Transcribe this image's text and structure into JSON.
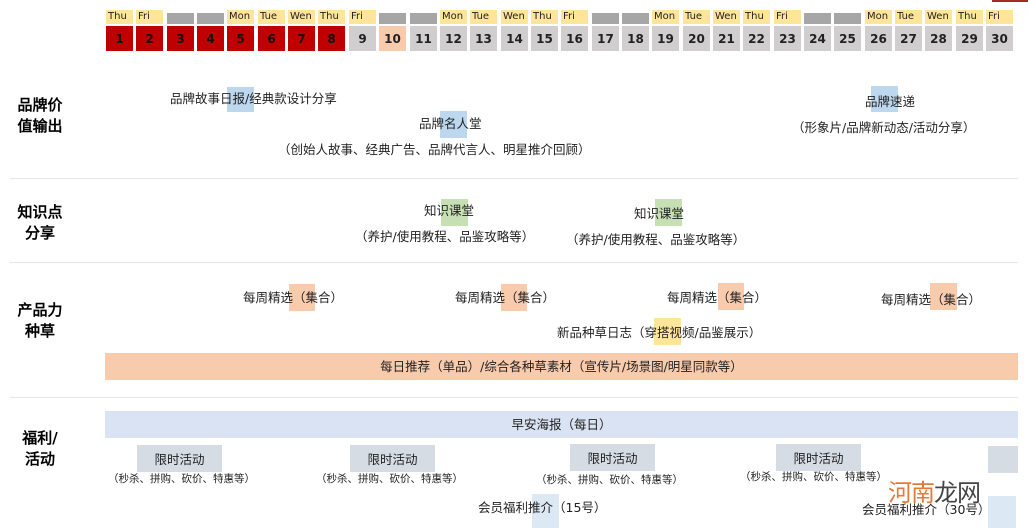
{
  "calendar": {
    "days": [
      {
        "date": "1",
        "dow": "Thu",
        "weekend": false,
        "status": "red"
      },
      {
        "date": "2",
        "dow": "Fri",
        "weekend": false,
        "status": "red"
      },
      {
        "date": "3",
        "dow": "",
        "weekend": true,
        "status": "red"
      },
      {
        "date": "4",
        "dow": "",
        "weekend": true,
        "status": "red"
      },
      {
        "date": "5",
        "dow": "Mon",
        "weekend": false,
        "status": "red"
      },
      {
        "date": "6",
        "dow": "Tue",
        "weekend": false,
        "status": "red"
      },
      {
        "date": "7",
        "dow": "Wen",
        "weekend": false,
        "status": "red"
      },
      {
        "date": "8",
        "dow": "Thu",
        "weekend": false,
        "status": "red"
      },
      {
        "date": "9",
        "dow": "Fri",
        "weekend": false,
        "status": "grey"
      },
      {
        "date": "10",
        "dow": "",
        "weekend": true,
        "status": "peach"
      },
      {
        "date": "11",
        "dow": "",
        "weekend": true,
        "status": "grey"
      },
      {
        "date": "12",
        "dow": "Mon",
        "weekend": false,
        "status": "grey"
      },
      {
        "date": "13",
        "dow": "Tue",
        "weekend": false,
        "status": "grey"
      },
      {
        "date": "14",
        "dow": "Wen",
        "weekend": false,
        "status": "grey"
      },
      {
        "date": "15",
        "dow": "Thu",
        "weekend": false,
        "status": "grey"
      },
      {
        "date": "16",
        "dow": "Fri",
        "weekend": false,
        "status": "grey"
      },
      {
        "date": "17",
        "dow": "",
        "weekend": true,
        "status": "grey"
      },
      {
        "date": "18",
        "dow": "",
        "weekend": true,
        "status": "grey"
      },
      {
        "date": "19",
        "dow": "Mon",
        "weekend": false,
        "status": "grey"
      },
      {
        "date": "20",
        "dow": "Tue",
        "weekend": false,
        "status": "grey"
      },
      {
        "date": "21",
        "dow": "Wen",
        "weekend": false,
        "status": "grey"
      },
      {
        "date": "22",
        "dow": "Thu",
        "weekend": false,
        "status": "grey"
      },
      {
        "date": "23",
        "dow": "Fri",
        "weekend": false,
        "status": "grey"
      },
      {
        "date": "24",
        "dow": "",
        "weekend": true,
        "status": "grey"
      },
      {
        "date": "25",
        "dow": "",
        "weekend": true,
        "status": "grey"
      },
      {
        "date": "26",
        "dow": "Mon",
        "weekend": false,
        "status": "grey"
      },
      {
        "date": "27",
        "dow": "Tue",
        "weekend": false,
        "status": "grey"
      },
      {
        "date": "28",
        "dow": "Wen",
        "weekend": false,
        "status": "grey"
      },
      {
        "date": "29",
        "dow": "Thu",
        "weekend": false,
        "status": "grey"
      },
      {
        "date": "30",
        "dow": "Fri",
        "weekend": false,
        "status": "grey"
      }
    ]
  },
  "sections": {
    "brand": {
      "label_line1": "品牌价",
      "label_line2": "值输出",
      "daily_story": "品牌故事日报/经典款设计分享",
      "hall_of_fame": "品牌名人堂",
      "hall_of_fame_sub": "（创始人故事、经典广告、品牌代言人、明星推介回顾）",
      "brand_express": "品牌速递",
      "brand_express_sub": "（形象片/品牌新动态/活动分享）"
    },
    "knowledge": {
      "label_line1": "知识点",
      "label_line2": "分享",
      "class_title": "知识课堂",
      "class_sub": "（养护/使用教程、品鉴攻略等）"
    },
    "product": {
      "label_line1": "产品力",
      "label_line2": "种草",
      "weekly_pick": "每周精选（集合）",
      "new_product_log": "新品种草日志（穿搭视频/品鉴展示）",
      "daily_band": "每日推荐（单品）/综合各种草素材（宣传片/场景图/明星同款等）"
    },
    "benefit": {
      "label_line1": "福利/",
      "label_line2": "活动",
      "morning_band": "早安海报（每日）",
      "flash_sale": "限时活动",
      "flash_sale_sub": "（秒杀、拼购、砍价、特惠等）",
      "member_15": "会员福利推介（15号）",
      "member_30": "会员福利推介（30号）"
    }
  },
  "watermark": {
    "part1": "河南",
    "part2": "龙网"
  },
  "colors": {
    "past_day": "#c00000",
    "future_day": "#d0cece",
    "today": "#f8cbad",
    "weekday_header": "#ffe599",
    "weekend_header": "#a6a6a6",
    "brand_highlight": "#bdd7ee",
    "knowledge_highlight": "#c6e0b4",
    "product_highlight": "#f8cbad",
    "benefit_band": "#dae3f3"
  }
}
